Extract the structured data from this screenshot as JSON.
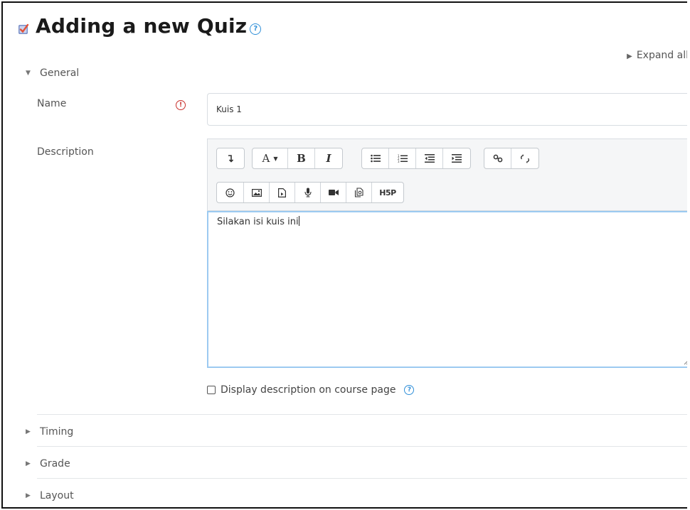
{
  "page": {
    "title": "Adding a new Quiz",
    "expand_all": "Expand all"
  },
  "sections": {
    "general": "General",
    "timing": "Timing",
    "grade": "Grade",
    "layout": "Layout"
  },
  "form": {
    "name_label": "Name",
    "name_value": "Kuis 1",
    "description_label": "Description",
    "description_text": "Silakan isi kuis ini",
    "display_description_label": "Display description on course page",
    "display_description_checked": false
  },
  "editor_toolbar": {
    "row1": [
      "collapse",
      "font-color",
      "bold",
      "italic",
      "unordered-list",
      "ordered-list",
      "outdent",
      "indent",
      "link",
      "unlink"
    ],
    "row2": [
      "emoticon",
      "image",
      "media",
      "record-audio",
      "record-video",
      "manage-files",
      "h5p"
    ],
    "labels": {
      "bold": "B",
      "italic": "I",
      "font": "A",
      "h5p": "H5P"
    }
  },
  "colors": {
    "accent_help": "#2f8fd8",
    "required": "#c9302c",
    "editor_focus_border": "#9ccaf1"
  }
}
